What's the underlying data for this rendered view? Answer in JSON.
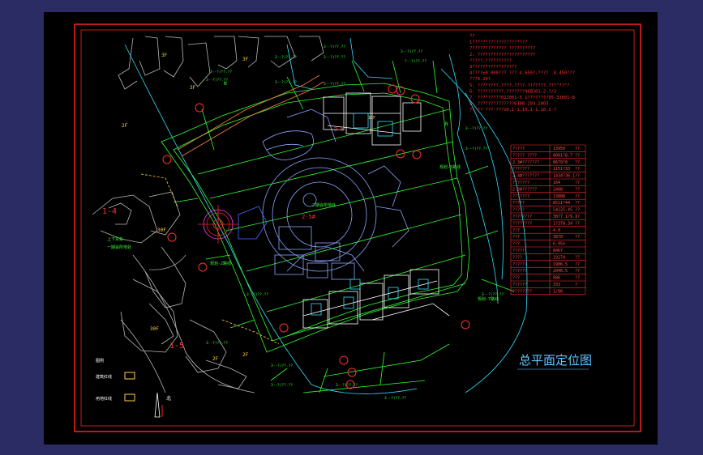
{
  "colors": {
    "app_bg": "#2b2c63",
    "canvas_bg": "#000000",
    "frame": "#ff2020",
    "note_text": "#ff3030",
    "table_line": "#ff3030",
    "table_text": "#ff5050",
    "title": "#5fc8ff",
    "green": "#30ff30",
    "cyan": "#30e0ff",
    "white": "#ffffff",
    "yellow": "#ffd040",
    "magenta": "#ff40ff",
    "gray": "#b8b8b8",
    "orange": "#ff8040",
    "blue": "#4f6bff"
  },
  "title": "总平面定位图",
  "notes": [
    "??",
    "1?????????????????????",
    "  ?????????????? ??????????",
    "2. ??????????????????????",
    "  ?????,??????????",
    "3?????????????????",
    "4????±0.000??? ??? 4.650?,???? -0.450???",
    "  ???4.20?.",
    "5. ????????,????.????.???????,???\"??\"?.",
    "6. ??????????.???????96BJ01-2-?/2",
    "7. ?????????02J001-5 1????????95-3J001-8",
    "8. ??????????????6J08-103-2003",
    "??'??'???'???10,1-1,10,1-1,10,1-?"
  ],
  "table_rows": [
    {
      "label": "?????",
      "value": "13950",
      "unit": "??"
    },
    {
      "label": "????? ????",
      "value": "8091?8.7",
      "unit": "??"
    },
    {
      "label": "2-3#???????",
      "value": "8679?8",
      "unit": "??"
    },
    {
      "label": "???????",
      "value": "1151?33",
      "unit": "??"
    },
    {
      "label": "2-4#???????",
      "value": "1434?36.1",
      "unit": "??"
    },
    {
      "label": "???????",
      "value": "164",
      "unit": "??"
    },
    {
      "label": "2-3#??????",
      "value": "2408",
      "unit": "??"
    },
    {
      "label": "???????",
      "value": "13888",
      "unit": "??"
    },
    {
      "label": "?????",
      "value": "8511?44",
      "unit": "??"
    },
    {
      "label": "?????",
      "value": "54225.45",
      "unit": "??"
    },
    {
      "label": "????????",
      "value": "3877.1?9.1",
      "unit": "??"
    },
    {
      "label": "????????",
      "value": "1?378.34",
      "unit": "??"
    },
    {
      "label": "???",
      "value": "4.0",
      "unit": ""
    },
    {
      "label": "???",
      "value": "3878",
      "unit": "??"
    },
    {
      "label": "???",
      "value": "6.95%",
      "unit": ""
    },
    {
      "label": "?????",
      "value": "8467",
      "unit": ""
    },
    {
      "label": "????",
      "value": "19274",
      "unit": "??"
    },
    {
      "label": "??????",
      "value": "1906.5",
      "unit": "??"
    },
    {
      "label": "??????",
      "value": "2046.5",
      "unit": "??"
    },
    {
      "label": "???",
      "value": "886",
      "unit": "??"
    },
    {
      "label": "??????",
      "value": "333",
      "unit": "?"
    },
    {
      "label": "????????",
      "value": "1/96",
      "unit": ""
    }
  ],
  "plan_labels": {
    "block_1_4": "1-4",
    "block_1_5": "1-5",
    "block_2_5a": "2-5#",
    "block_2_5b": "2-5",
    "label_30f": "30F",
    "label_16f": "16F",
    "label_3f": "3F",
    "label_2f": "2F",
    "north": "N",
    "subway_label": "上下车处",
    "lobby_label": "一期会所地处",
    "garage_label": "二期会所地处",
    "road_a": "规划-2路线",
    "road_b": "规划-5路线",
    "road_c": "规划-7路线",
    "legend_1": "图例",
    "legend_2": "建筑红线",
    "legend_3": "用地红线",
    "north_arrow": "北"
  }
}
